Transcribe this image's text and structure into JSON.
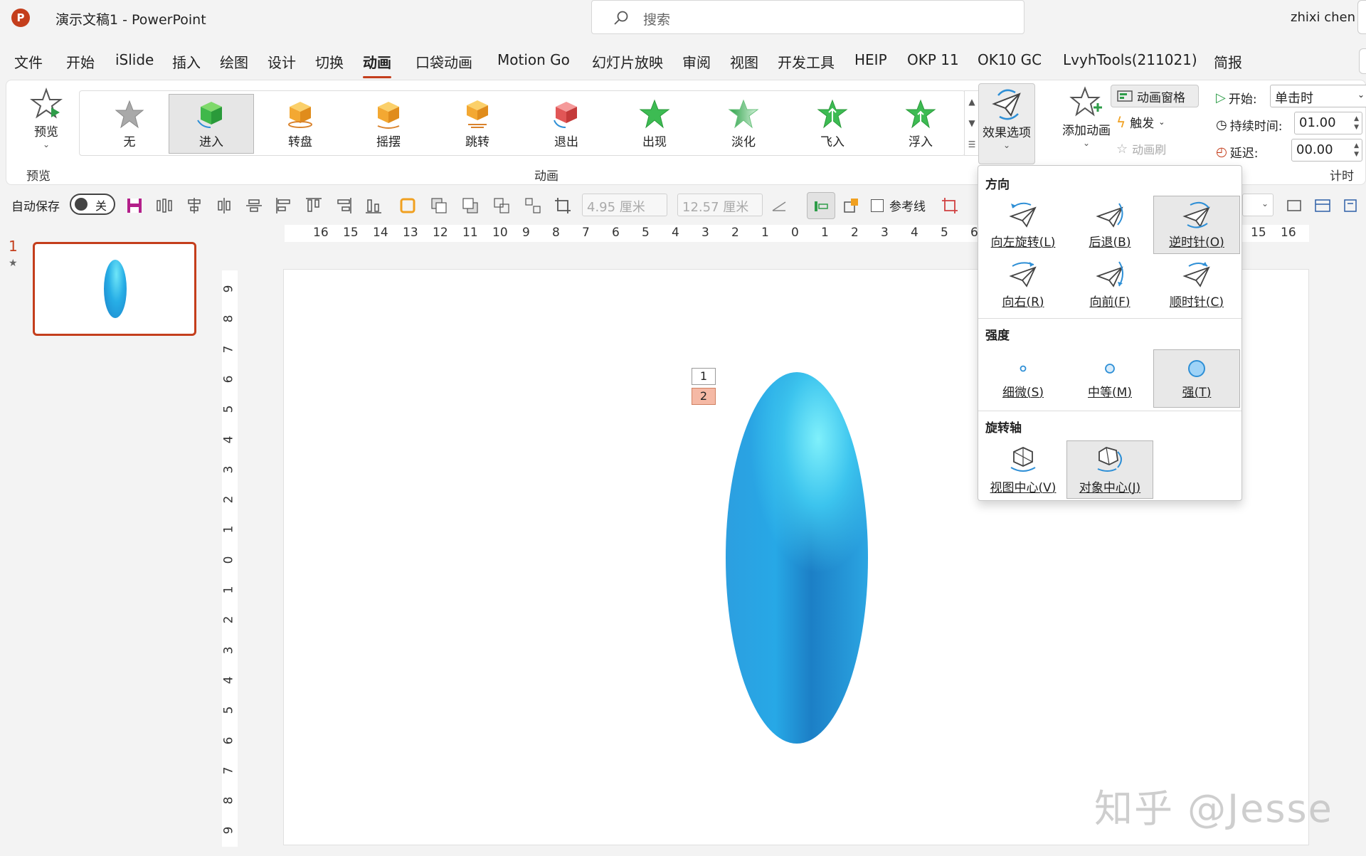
{
  "titlebar": {
    "app_icon": "P",
    "title": "演示文稿1  -  PowerPoint",
    "search_placeholder": "搜索",
    "user": "zhixi chen"
  },
  "menu": {
    "tabs": [
      "文件",
      "开始",
      "iSlide",
      "插入",
      "绘图",
      "设计",
      "切换",
      "动画",
      "口袋动画",
      "Motion Go",
      "幻灯片放映",
      "审阅",
      "视图",
      "开发工具",
      "HEIP",
      "OKP 11",
      "OK10 GC",
      "LvyhTools(211021)",
      "简报"
    ],
    "active": "动画"
  },
  "ribbon": {
    "preview": {
      "label": "预览",
      "group": "预览"
    },
    "gallery": {
      "group": "动画",
      "items": [
        {
          "label": "无",
          "icon": "none-star-icon"
        },
        {
          "label": "进入",
          "icon": "cube-enter-icon",
          "selected": true
        },
        {
          "label": "转盘",
          "icon": "cube-turntable-icon"
        },
        {
          "label": "摇摆",
          "icon": "cube-swing-icon"
        },
        {
          "label": "跳转",
          "icon": "cube-jump-icon"
        },
        {
          "label": "退出",
          "icon": "cube-exit-icon"
        },
        {
          "label": "出现",
          "icon": "star-appear-icon"
        },
        {
          "label": "淡化",
          "icon": "star-fade-icon"
        },
        {
          "label": "飞入",
          "icon": "star-flyin-icon"
        },
        {
          "label": "浮入",
          "icon": "star-floatin-icon"
        }
      ]
    },
    "effect_options": "效果选项",
    "add_animation": "添加动画",
    "animation_pane": "动画窗格",
    "trigger": "触发",
    "animation_painter": "动画刷",
    "timing": {
      "group": "计时",
      "start_label": "开始:",
      "start_value": "单击时",
      "duration_label": "持续时间:",
      "duration_value": "01.00",
      "delay_label": "延迟:",
      "delay_value": "00.00"
    }
  },
  "qat": {
    "autosave_label": "自动保存",
    "autosave_state": "关",
    "width_value": "4.95 厘米",
    "height_value": "12.57 厘米",
    "guides_label": "参考线"
  },
  "slides": {
    "number": "1"
  },
  "rulers": {
    "horizontal": [
      "16",
      "15",
      "14",
      "13",
      "12",
      "11",
      "10",
      "9",
      "8",
      "7",
      "6",
      "5",
      "4",
      "3",
      "2",
      "1",
      "0",
      "1",
      "2",
      "3",
      "4",
      "5",
      "6",
      "15",
      "16"
    ],
    "vertical": [
      "9",
      "8",
      "7",
      "6",
      "5",
      "4",
      "3",
      "2",
      "1",
      "0",
      "1",
      "2",
      "3",
      "4",
      "5",
      "6",
      "7",
      "8",
      "9"
    ]
  },
  "canvas": {
    "tags": [
      "1",
      "2"
    ],
    "watermark": "知乎 @Jesse"
  },
  "dropdown": {
    "direction": {
      "heading": "方向",
      "items": [
        {
          "label": "向左旋转(L)",
          "selected": false
        },
        {
          "label": "后退(B)",
          "selected": false
        },
        {
          "label": "逆时针(O)",
          "selected": true
        },
        {
          "label": "向右(R)",
          "selected": false
        },
        {
          "label": "向前(F)",
          "selected": false
        },
        {
          "label": "顺时针(C)",
          "selected": false
        }
      ]
    },
    "intensity": {
      "heading": "强度",
      "items": [
        {
          "label": "细微(S)",
          "selected": false
        },
        {
          "label": "中等(M)",
          "selected": false
        },
        {
          "label": "强(T)",
          "selected": true
        }
      ]
    },
    "axis": {
      "heading": "旋转轴",
      "items": [
        {
          "label": "视图中心(V)",
          "selected": false
        },
        {
          "label": "对象中心(J)",
          "selected": true
        }
      ]
    }
  },
  "colors": {
    "accent": "#c43e1c",
    "ellipse_light": "#7ff0fb",
    "ellipse_dark": "#1c7fc6"
  }
}
